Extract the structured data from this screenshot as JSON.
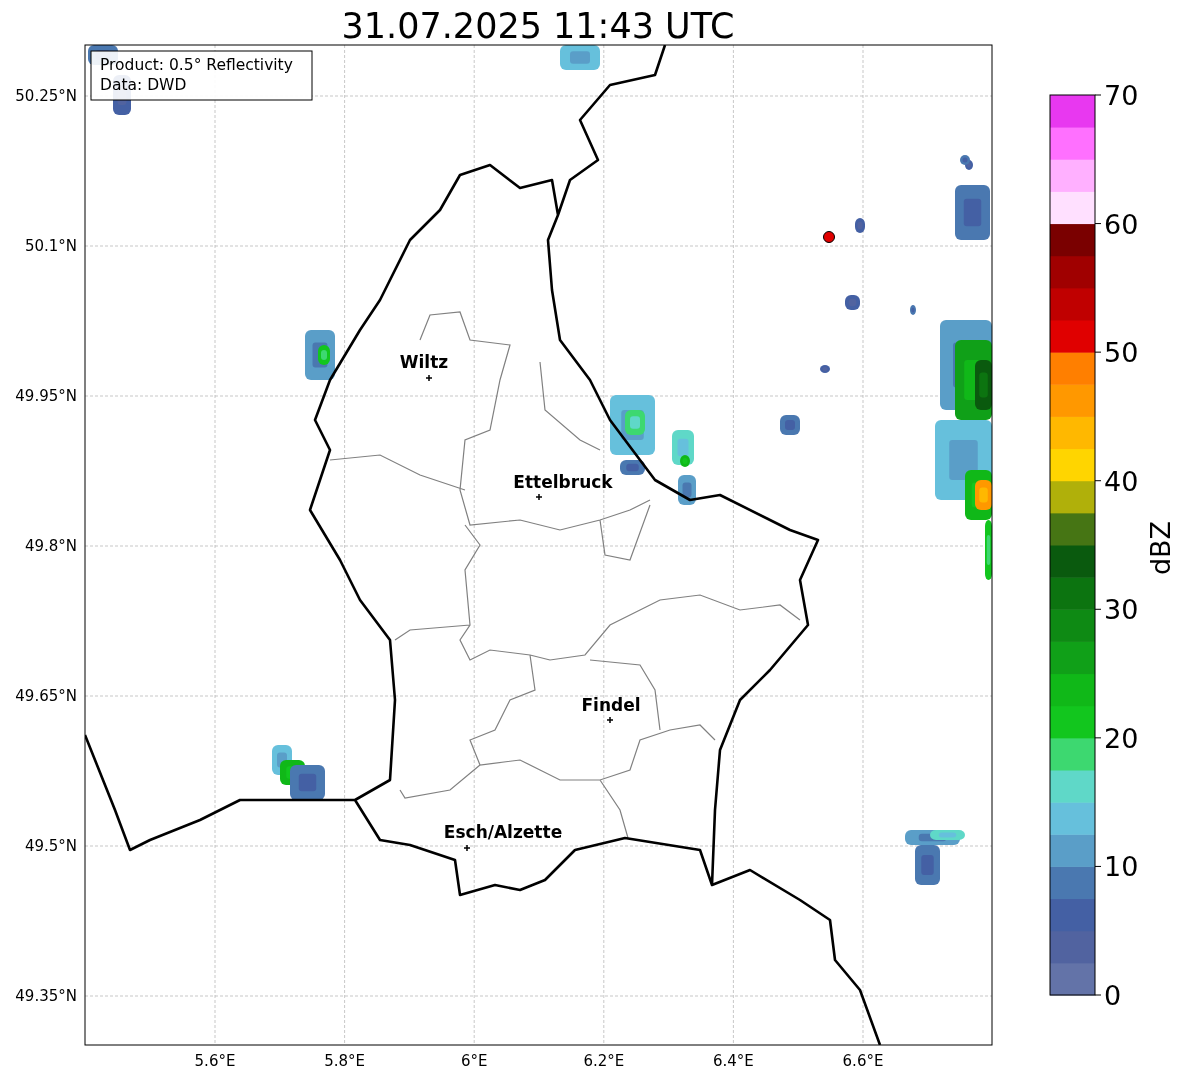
{
  "title": "31.07.2025 11:43 UTC",
  "map": {
    "info_box": [
      "Product: 0.5° Reflectivity",
      "Data: DWD"
    ],
    "lat_labels": [
      "50.25°N",
      "50.1°N",
      "49.95°N",
      "49.8°N",
      "49.65°N",
      "49.5°N",
      "49.35°N"
    ],
    "lon_labels": [
      "5.6°E",
      "5.8°E",
      "6°E",
      "6.2°E",
      "6.4°E",
      "6.6°E"
    ],
    "cities": [
      {
        "name": "Wiltz"
      },
      {
        "name": "Ettelbruck"
      },
      {
        "name": "Findel"
      },
      {
        "name": "Esch/Alzette"
      }
    ]
  },
  "colorbar": {
    "label": "dBZ",
    "ticks": [
      "70",
      "60",
      "50",
      "40",
      "30",
      "20",
      "10",
      "0"
    ],
    "bins": [
      {
        "color": "#6373a8"
      },
      {
        "color": "#5163a0"
      },
      {
        "color": "#4460a4"
      },
      {
        "color": "#4a78b0"
      },
      {
        "color": "#5a9ec8"
      },
      {
        "color": "#66c0dc"
      },
      {
        "color": "#5fd8c8"
      },
      {
        "color": "#3dd870"
      },
      {
        "color": "#12c61e"
      },
      {
        "color": "#10b818"
      },
      {
        "color": "#10a018"
      },
      {
        "color": "#0e8a14"
      },
      {
        "color": "#0c7410"
      },
      {
        "color": "#0a5a0e"
      },
      {
        "color": "#467514"
      },
      {
        "color": "#b0b00a"
      },
      {
        "color": "#ffd500"
      },
      {
        "color": "#ffb800"
      },
      {
        "color": "#ff9800"
      },
      {
        "color": "#ff7f00"
      },
      {
        "color": "#e00000"
      },
      {
        "color": "#c00000"
      },
      {
        "color": "#a00000"
      },
      {
        "color": "#7a0000"
      },
      {
        "color": "#ffe0ff"
      },
      {
        "color": "#ffb0ff"
      },
      {
        "color": "#ff70ff"
      },
      {
        "color": "#e838f0"
      }
    ]
  }
}
